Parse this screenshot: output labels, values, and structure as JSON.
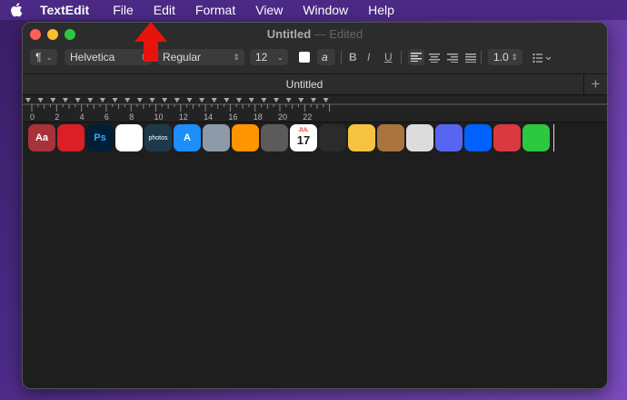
{
  "menubar": {
    "app_name": "TextEdit",
    "items": [
      "File",
      "Edit",
      "Format",
      "View",
      "Window",
      "Help"
    ]
  },
  "window": {
    "title": "Untitled",
    "edited_suffix": "— Edited",
    "tab_label": "Untitled",
    "tab_add": "+"
  },
  "toolbar": {
    "paragraph_style": "¶",
    "font_family": "Helvetica",
    "font_style": "Regular",
    "font_size": "12",
    "bold": "B",
    "italic": "I",
    "underline": "U",
    "line_spacing": "1.0"
  },
  "ruler": {
    "marks": [
      "0",
      "2",
      "4",
      "6",
      "8",
      "10",
      "12",
      "14",
      "16",
      "18",
      "20",
      "22"
    ]
  },
  "document": {
    "app_icons": [
      {
        "name": "dictionary-app-icon",
        "label": "Aa",
        "color": "#a8323a"
      },
      {
        "name": "creative-cloud-app-icon",
        "label": "",
        "color": "#da1f26"
      },
      {
        "name": "photoshop-app-icon",
        "label": "Ps",
        "color": "#001e36"
      },
      {
        "name": "airtable-app-icon",
        "label": "",
        "color": "#ffffff"
      },
      {
        "name": "amazon-photos-app-icon",
        "label": "photos",
        "color": "#1d3a4b"
      },
      {
        "name": "app-store-app-icon",
        "label": "A",
        "color": "#1c8ef9"
      },
      {
        "name": "automator-app-icon",
        "label": "",
        "color": "#8e9aa8"
      },
      {
        "name": "books-app-icon",
        "label": "",
        "color": "#ff9500"
      },
      {
        "name": "calculator-app-icon",
        "label": "",
        "color": "#5b5b5b"
      },
      {
        "name": "calendar-app-icon",
        "label": "17",
        "color": "#ffffff"
      },
      {
        "name": "chess-app-icon",
        "label": "",
        "color": "#2b2b2b"
      },
      {
        "name": "preview-app-icon",
        "label": "",
        "color": "#f5c242"
      },
      {
        "name": "contacts-app-icon",
        "label": "",
        "color": "#a9743d"
      },
      {
        "name": "camera-app-icon",
        "label": "",
        "color": "#dcdcdc"
      },
      {
        "name": "discord-app-icon",
        "label": "",
        "color": "#5865f2"
      },
      {
        "name": "dropbox-app-icon",
        "label": "",
        "color": "#0061fe"
      },
      {
        "name": "expressvpn-app-icon",
        "label": "",
        "color": "#da3940"
      },
      {
        "name": "facetime-app-icon",
        "label": "",
        "color": "#2bc840"
      }
    ],
    "calendar_month": "JUL"
  },
  "colors": {
    "menubar_bg": "#4b2a86",
    "window_bg": "#1e1e1e",
    "arrow": "#e8130c"
  }
}
